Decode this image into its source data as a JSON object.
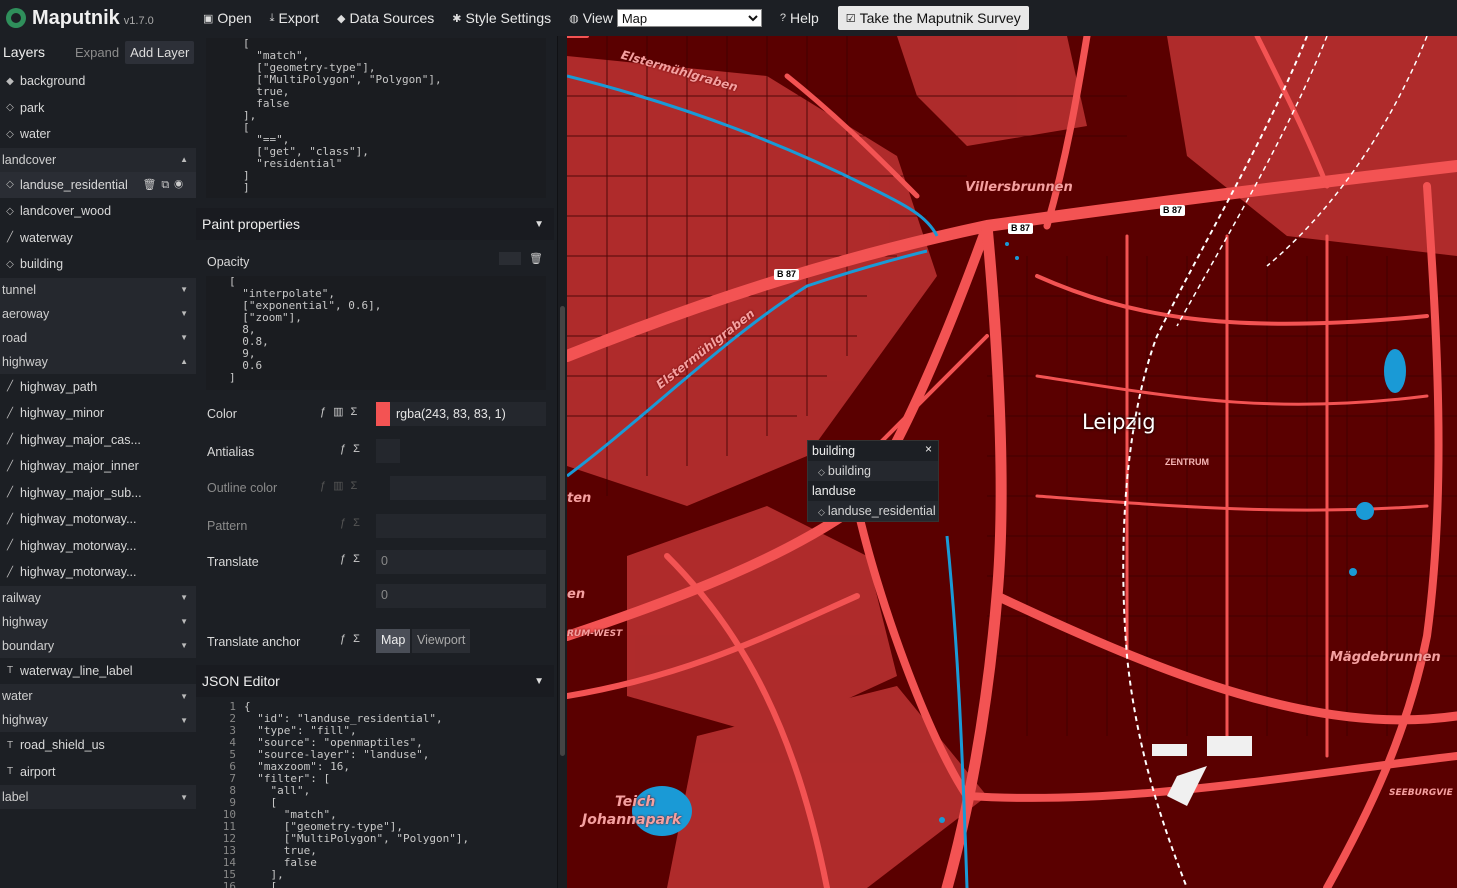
{
  "app": {
    "name": "Maputnik",
    "version": "v1.7.0"
  },
  "toolbar": {
    "open": "Open",
    "export": "Export",
    "data_sources": "Data Sources",
    "style_settings": "Style Settings",
    "view": "View",
    "view_selected": "Map",
    "help": "Help",
    "survey": "Take the Maputnik Survey"
  },
  "layer_list": {
    "title": "Layers",
    "expand": "Expand",
    "add_layer": "Add Layer",
    "rows": [
      {
        "kind": "layer",
        "icon": "fill-icon",
        "label": "background"
      },
      {
        "kind": "layer",
        "icon": "fill-outline-icon",
        "label": "park"
      },
      {
        "kind": "layer",
        "icon": "fill-outline-icon",
        "label": "water"
      },
      {
        "kind": "group",
        "label": "landcover",
        "open": true
      },
      {
        "kind": "layer",
        "icon": "fill-outline-icon",
        "label": "landuse_residential",
        "active": true
      },
      {
        "kind": "layer",
        "icon": "fill-outline-icon",
        "label": "landcover_wood"
      },
      {
        "kind": "layer",
        "icon": "line-icon",
        "label": "waterway"
      },
      {
        "kind": "layer",
        "icon": "fill-outline-icon",
        "label": "building"
      },
      {
        "kind": "group",
        "label": "tunnel"
      },
      {
        "kind": "group",
        "label": "aeroway"
      },
      {
        "kind": "group",
        "label": "road"
      },
      {
        "kind": "group",
        "label": "highway",
        "open": true
      },
      {
        "kind": "layer",
        "icon": "line-icon",
        "label": "highway_path"
      },
      {
        "kind": "layer",
        "icon": "line-icon",
        "label": "highway_minor"
      },
      {
        "kind": "layer",
        "icon": "line-icon",
        "label": "highway_major_cas..."
      },
      {
        "kind": "layer",
        "icon": "line-icon",
        "label": "highway_major_inner"
      },
      {
        "kind": "layer",
        "icon": "line-icon",
        "label": "highway_major_sub..."
      },
      {
        "kind": "layer",
        "icon": "line-icon",
        "label": "highway_motorway..."
      },
      {
        "kind": "layer",
        "icon": "line-icon",
        "label": "highway_motorway..."
      },
      {
        "kind": "layer",
        "icon": "line-icon",
        "label": "highway_motorway..."
      },
      {
        "kind": "group",
        "label": "railway"
      },
      {
        "kind": "group",
        "label": "highway"
      },
      {
        "kind": "group",
        "label": "boundary"
      },
      {
        "kind": "layer",
        "icon": "symbol-icon",
        "label": "waterway_line_label"
      },
      {
        "kind": "group",
        "label": "water"
      },
      {
        "kind": "group",
        "label": "highway"
      },
      {
        "kind": "layer",
        "icon": "symbol-icon",
        "label": "road_shield_us"
      },
      {
        "kind": "layer",
        "icon": "symbol-icon",
        "label": "airport"
      },
      {
        "kind": "group",
        "label": "label"
      }
    ]
  },
  "editor": {
    "filter_code": "[\n  \"match\",\n  [\"geometry-type\"],\n  [\"MultiPolygon\", \"Polygon\"],\n  true,\n  false\n],\n[\n  \"==\",\n  [\"get\", \"class\"],\n  \"residential\"\n]\n]",
    "paint_title": "Paint properties",
    "opacity_label": "Opacity",
    "opacity_code": "[\n  \"interpolate\",\n  [\"exponential\", 0.6],\n  [\"zoom\"],\n  8,\n  0.8,\n  9,\n  0.6\n]",
    "color_label": "Color",
    "color_value": "rgba(243, 83, 83, 1)",
    "color_swatch": "#f35353",
    "antialias_label": "Antialias",
    "outline_color_label": "Outline color",
    "pattern_label": "Pattern",
    "translate_label": "Translate",
    "translate_x_placeholder": "0",
    "translate_y_placeholder": "0",
    "translate_anchor_label": "Translate anchor",
    "anchor_map": "Map",
    "anchor_viewport": "Viewport",
    "json_title": "JSON Editor",
    "json_lines": [
      "{",
      "  \"id\": \"landuse_residential\",",
      "  \"type\": \"fill\",",
      "  \"source\": \"openmaptiles\",",
      "  \"source-layer\": \"landuse\",",
      "  \"maxzoom\": 16,",
      "  \"filter\": [",
      "    \"all\",",
      "    [",
      "      \"match\",",
      "      [\"geometry-type\"],",
      "      [\"MultiPolygon\", \"Polygon\"],",
      "      true,",
      "      false",
      "    ],",
      "    ["
    ]
  },
  "map": {
    "city": "Leipzig",
    "district": "ZENTRUM",
    "labels": [
      "Elstermühlgraben",
      "Elstermühlgraben",
      "Villersbrunnen",
      "Mägdebrunnen",
      "Teich",
      "Johannapark",
      "ten",
      "en",
      "RUM-WEST",
      "SEEBURGVIE"
    ],
    "shields": [
      "B 87",
      "B 87",
      "B 87"
    ],
    "colors": {
      "land": "#5a0000",
      "road": "#f35353",
      "water": "#1a9ad6",
      "residential": "#b83030"
    }
  },
  "popup": {
    "groups": [
      {
        "title": "building",
        "items": [
          "building"
        ]
      },
      {
        "title": "landuse",
        "items": [
          "landuse_residential"
        ]
      }
    ]
  }
}
